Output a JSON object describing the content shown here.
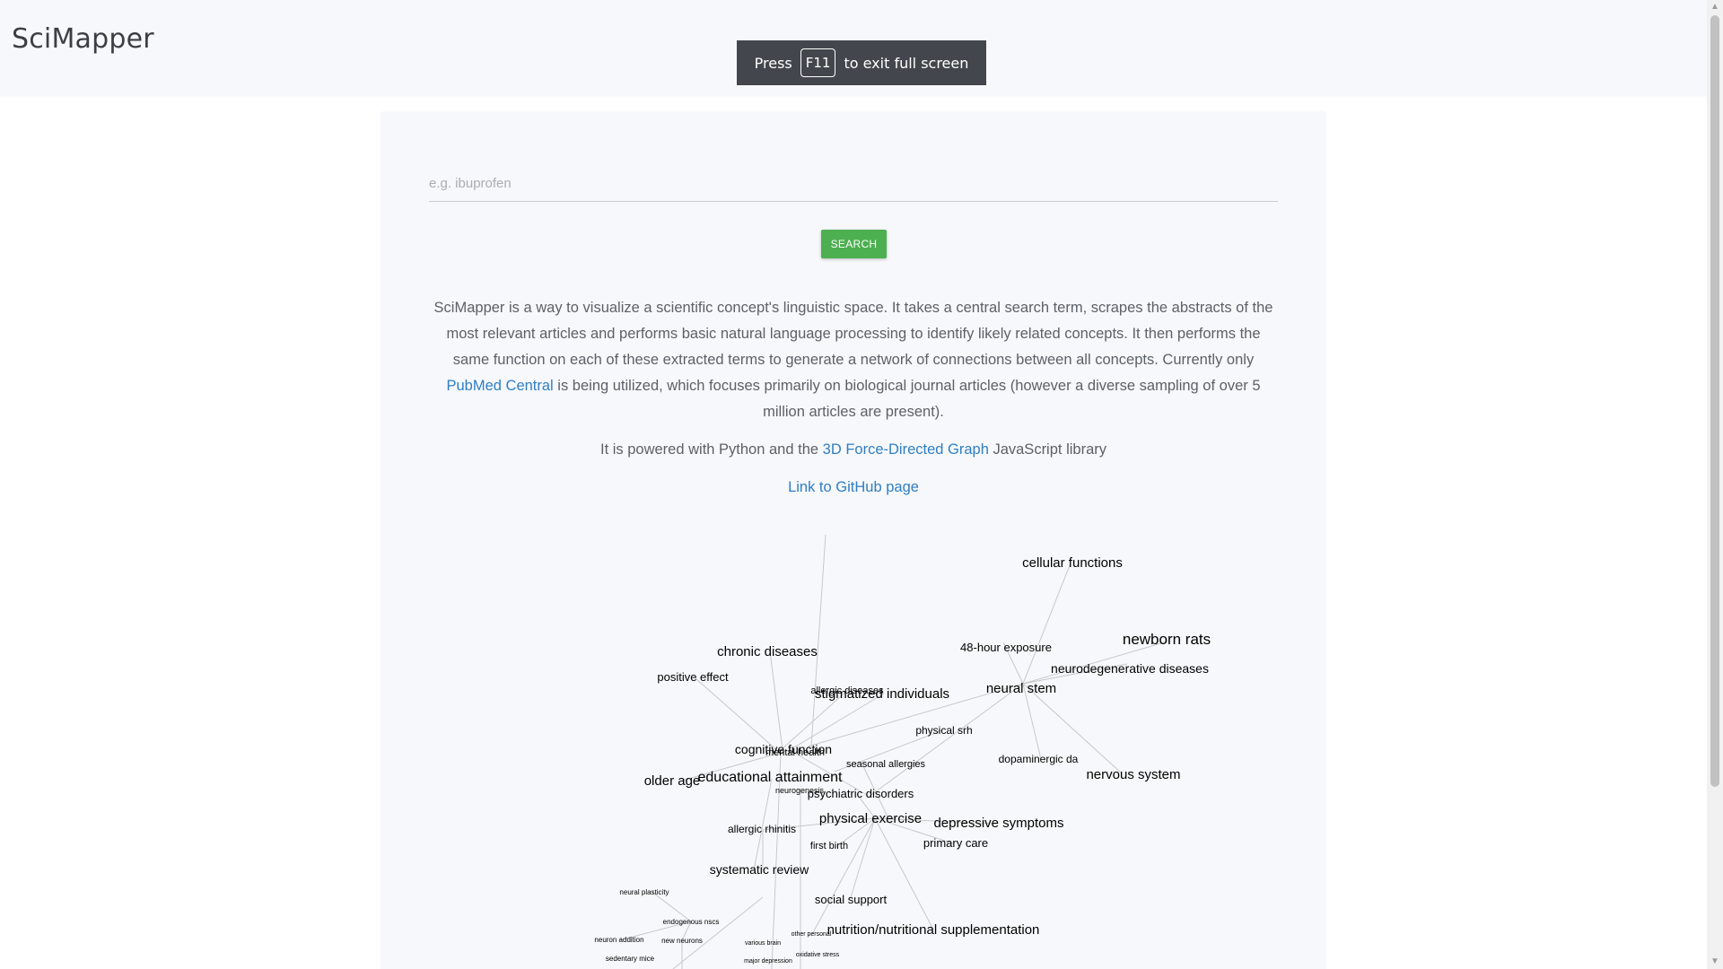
{
  "app": {
    "brand": "SciMapper"
  },
  "fullscreen_notice": {
    "before": "Press",
    "key": "F11",
    "after": "to exit full screen"
  },
  "search": {
    "placeholder": "e.g. ibuprofen",
    "value": "",
    "button_label": "SEARCH"
  },
  "intro": {
    "paragraph_start": "SciMapper is a way to visualize a scientific concept's linguistic space. It takes a central search term, scrapes the abstracts of the most relevant articles and performs basic natural language processing to identify likely related concepts. It then performs the same function on each of these extracted terms to generate a network of connections between all concepts. Currently only ",
    "pubmed_link": "PubMed Central",
    "paragraph_end": " is being utilized, which focuses primarily on biological journal articles (however a diverse sampling of over 5 million articles are present).",
    "powered_start": "It is powered with Python and the ",
    "graph_lib_link": "3D Force-Directed Graph",
    "powered_end": " JavaScript library",
    "github_link": "Link to GitHub page"
  },
  "graph": {
    "labels": [
      "cellular functions",
      "newborn rats",
      "48-hour exposure",
      "neurodegenerative diseases",
      "neural stem",
      "chronic diseases",
      "positive effect",
      "allergic diseases",
      "stigmatized individuals",
      "physical srh",
      "cognitive function",
      "mental health",
      "seasonal allergies",
      "dopaminergic da",
      "nervous system",
      "older age",
      "educational attainment",
      "neurogenesis",
      "psychiatric disorders",
      "physical exercise",
      "depressive symptoms",
      "allergic rhinitis",
      "first birth",
      "primary care",
      "systematic review",
      "social support",
      "nutrition/nutritional supplementation",
      "neural plasticity",
      "endogenous nscs",
      "neuron addition",
      "new neurons",
      "sedentary mice",
      "various brain",
      "other personal",
      "major depression",
      "oxidative stress"
    ]
  }
}
